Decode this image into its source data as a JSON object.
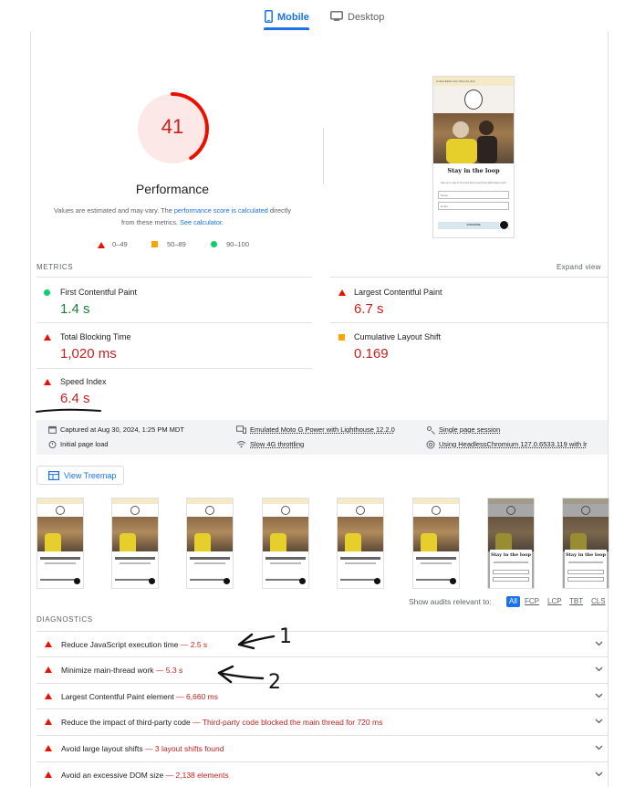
{
  "tabs": {
    "mobile": "Mobile",
    "desktop": "Desktop"
  },
  "gauge": {
    "score": "41",
    "score_value": 41,
    "title": "Performance",
    "color": "#c5221f"
  },
  "description": {
    "prefix": "Values are estimated and may vary. The ",
    "link1": "performance score is calculated",
    "middle": " directly from these metrics. ",
    "link2": "See calculator."
  },
  "legend": {
    "fail": "0–49",
    "average": "50–89",
    "pass": "90–100"
  },
  "screenshot": {
    "bar_text": "Limited Edition Tee! Shop the drop",
    "modal_title": "Stay in the loop",
    "modal_desc": "Sign up to stay in the know about everything Wild Hippie ranch",
    "field1": "Name",
    "field2": "Email",
    "button": "SUBSCRIBE"
  },
  "metrics": {
    "header": "METRICS",
    "expand": "Expand view",
    "fcp": {
      "label": "First Contentful Paint",
      "value": "1.4 s",
      "status": "pass"
    },
    "lcp": {
      "label": "Largest Contentful Paint",
      "value": "6.7 s",
      "status": "fail"
    },
    "tbt": {
      "label": "Total Blocking Time",
      "value": "1,020 ms",
      "status": "fail"
    },
    "cls": {
      "label": "Cumulative Layout Shift",
      "value": "0.169",
      "status": "average"
    },
    "si": {
      "label": "Speed Index",
      "value": "6.4 s",
      "status": "fail"
    }
  },
  "info": {
    "captured": "Captured at Aug 30, 2024, 1:25 PM MDT",
    "initial": "Initial page load",
    "device": "Emulated Moto G Power with Lighthouse 12.2.0",
    "throttle": "Slow 4G throttling",
    "session": "Single page session",
    "browser": "Using HeadlessChromium 127.0.6533.119 with lr"
  },
  "treemap": {
    "label": "View Treemap"
  },
  "filter": {
    "label": "Show audits relevant to:",
    "chips": [
      "All",
      "FCP",
      "LCP",
      "TBT",
      "CLS"
    ]
  },
  "diagnostics": {
    "header": "DIAGNOSTICS",
    "items": [
      {
        "title": "Reduce JavaScript execution time",
        "display": "2.5 s"
      },
      {
        "title": "Minimize main-thread work",
        "display": "5.3 s"
      },
      {
        "title": "Largest Contentful Paint element",
        "display": "6,660 ms"
      },
      {
        "title": "Reduce the impact of third-party code",
        "display": "Third-party code blocked the main thread for 720 ms"
      },
      {
        "title": "Avoid large layout shifts",
        "display": "3 layout shifts found"
      },
      {
        "title": "Avoid an excessive DOM size",
        "display": "2,138 elements"
      }
    ]
  },
  "annotations": {
    "arrow1": "1",
    "arrow2": "2"
  },
  "colors": {
    "fail": "#eb0f00",
    "average": "#ffa400",
    "pass": "#0cce6b",
    "accent": "#1a73e8"
  }
}
